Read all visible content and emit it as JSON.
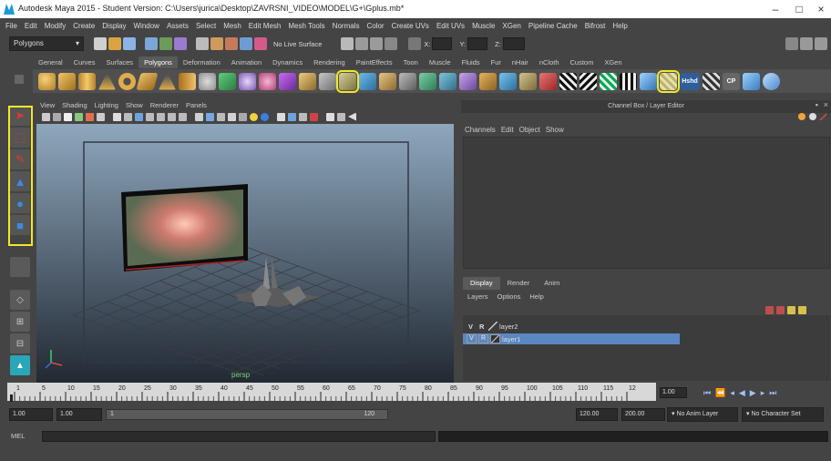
{
  "window": {
    "title": "Autodesk Maya 2015 - Student Version: C:\\Users\\jurica\\Desktop\\ZAVRSNI_VIDEO\\MODEL\\G+\\Gplus.mb*",
    "minimize": "–",
    "maximize": "□",
    "close": "×"
  },
  "menubar": [
    "File",
    "Edit",
    "Modify",
    "Create",
    "Display",
    "Window",
    "Assets",
    "Select",
    "Mesh",
    "Edit Mesh",
    "Mesh Tools",
    "Normals",
    "Color",
    "Create UVs",
    "Edit UVs",
    "Muscle",
    "XGen",
    "Pipeline Cache",
    "Bifrost",
    "Help"
  ],
  "statusline": {
    "menu_set": "Polygons",
    "live_surface": "No Live Surface",
    "x_label": "X:",
    "y_label": "Y:",
    "z_label": "Z:"
  },
  "shelf": {
    "tabs": [
      "General",
      "Curves",
      "Surfaces",
      "Polygons",
      "Deformation",
      "Animation",
      "Dynamics",
      "Rendering",
      "PaintEffects",
      "Toon",
      "Muscle",
      "Fluids",
      "Fur",
      "nHair",
      "nCloth",
      "Custom",
      "XGen"
    ],
    "active_tab": "Polygons",
    "icon_labels": {
      "hshd": "Hshd",
      "cp": "CP"
    }
  },
  "viewport": {
    "menu": [
      "View",
      "Shading",
      "Lighting",
      "Show",
      "Renderer",
      "Panels"
    ],
    "camera_label": "persp"
  },
  "channel_box": {
    "title": "Channel Box / Layer Editor",
    "menu": [
      "Channels",
      "Edit",
      "Object",
      "Show"
    ]
  },
  "layer_editor": {
    "tabs": [
      "Display",
      "Render",
      "Anim"
    ],
    "active_tab": "Display",
    "menu": [
      "Layers",
      "Options",
      "Help"
    ],
    "header_v": "V",
    "header_r": "R",
    "layers": [
      {
        "v": "",
        "r": "",
        "name": "layer2",
        "selected": false
      },
      {
        "v": "V",
        "r": "R",
        "name": "layer1",
        "selected": true
      }
    ]
  },
  "time_slider": {
    "ticks": [
      "1",
      "5",
      "10",
      "15",
      "20",
      "25",
      "30",
      "35",
      "40",
      "45",
      "50",
      "55",
      "60",
      "65",
      "70",
      "75",
      "80",
      "85",
      "90",
      "95",
      "100",
      "105",
      "110",
      "115",
      "12"
    ],
    "current_frame": "1.00"
  },
  "range": {
    "start": "1.00",
    "inner_start": "1.00",
    "slider_start": "1",
    "slider_end": "120",
    "inner_end": "120.00",
    "end": "200.00",
    "anim_layer": "No Anim Layer",
    "char_set": "No Character Set"
  },
  "mel": {
    "label": "MEL"
  }
}
